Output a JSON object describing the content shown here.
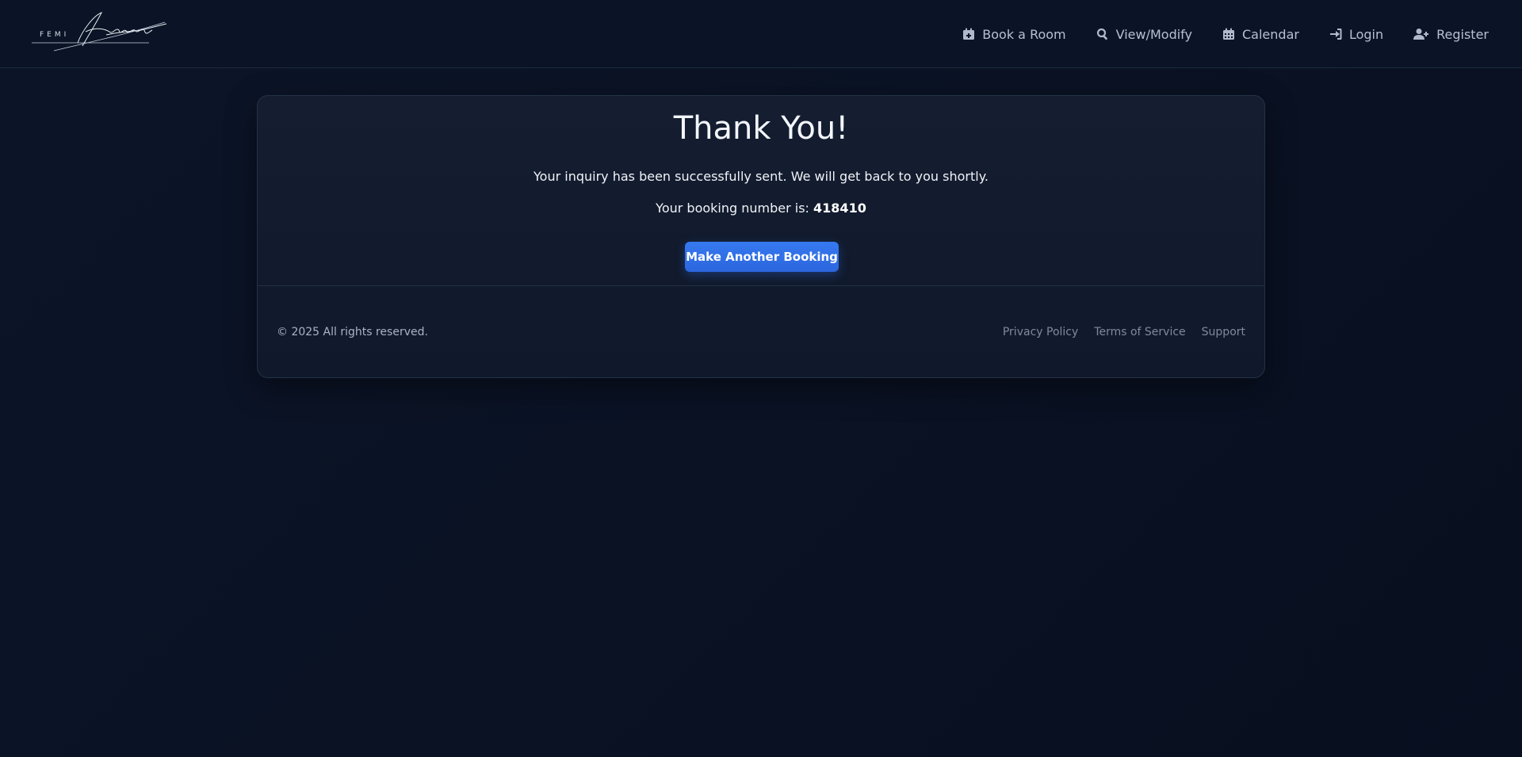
{
  "brand": {
    "logo_icon": "signature-logo"
  },
  "nav": {
    "items": [
      {
        "label": "Book a Room",
        "icon": "calendar-plus-icon"
      },
      {
        "label": "View/Modify",
        "icon": "search-icon"
      },
      {
        "label": "Calendar",
        "icon": "calendar-icon"
      },
      {
        "label": "Login",
        "icon": "sign-in-icon"
      },
      {
        "label": "Register",
        "icon": "user-plus-icon"
      }
    ]
  },
  "confirmation": {
    "title": "Thank You!",
    "message": "Your inquiry has been successfully sent. We will get back to you shortly.",
    "booking_prefix": "Your booking number is:",
    "booking_number": "418410",
    "cta_label": "Make Another Booking"
  },
  "footer": {
    "copyright": "© 2025 All rights reserved.",
    "links": [
      "Privacy Policy",
      "Terms of Service",
      "Support"
    ]
  },
  "colors": {
    "accent": "#2f6de6",
    "background": "#0a1224",
    "card": "#131c2e"
  }
}
